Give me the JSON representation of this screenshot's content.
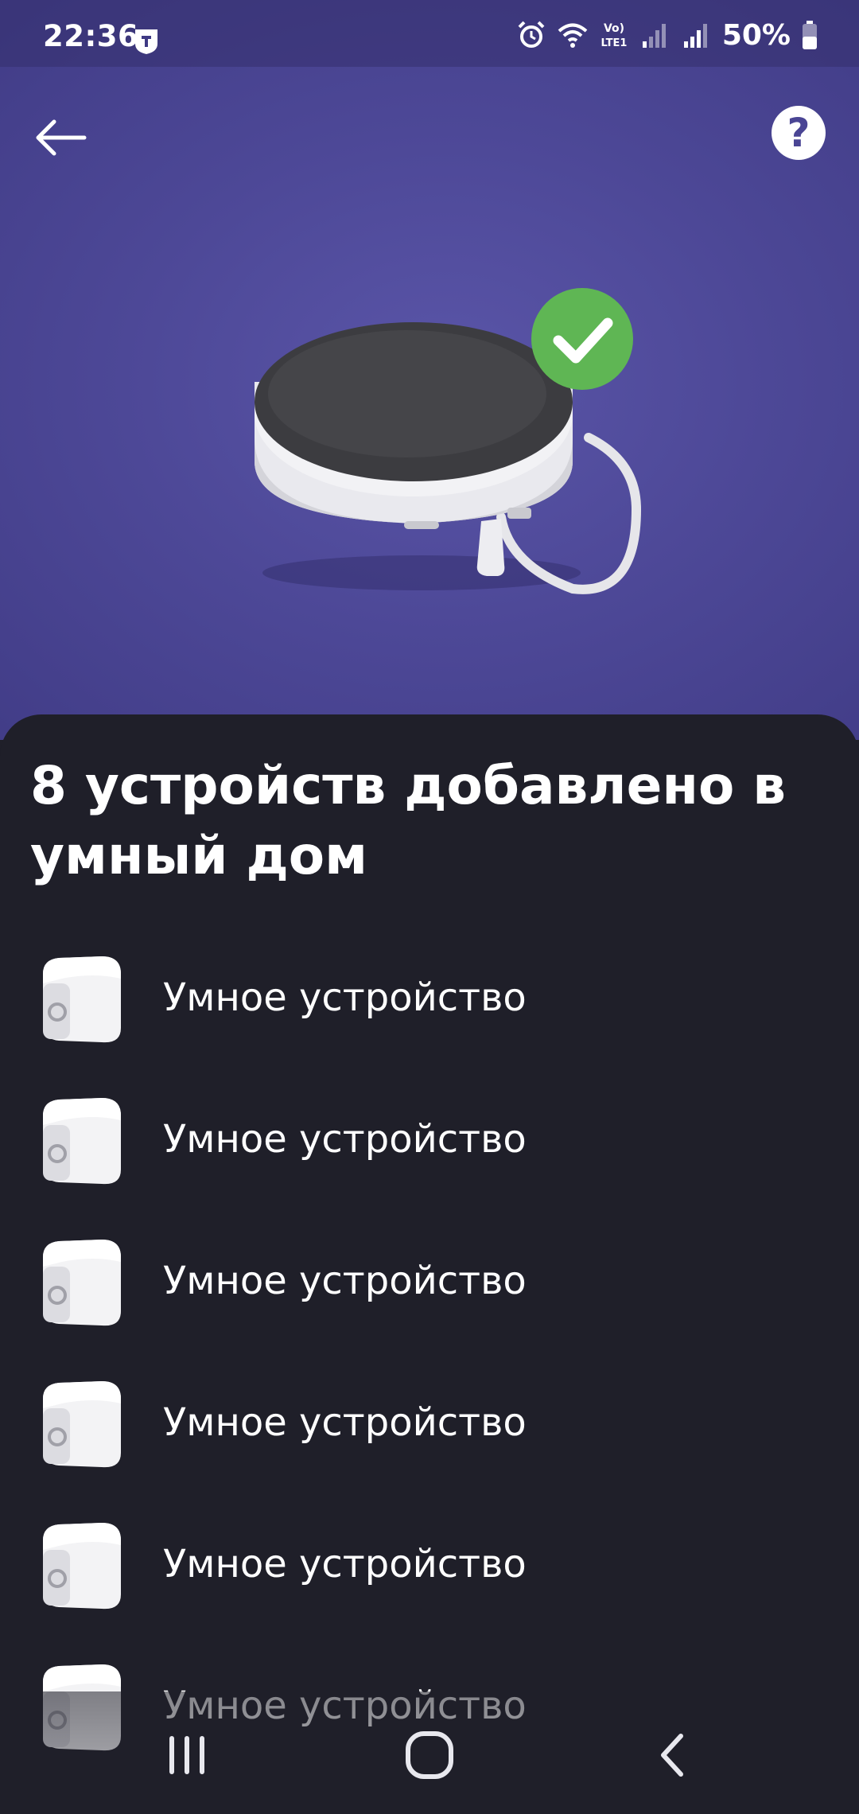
{
  "status_bar": {
    "time": "22:36",
    "battery_percent": "50%",
    "icons": [
      "tele2-icon",
      "alarm-icon",
      "wifi-icon",
      "volte-icon",
      "signal-icon",
      "signal-icon",
      "battery-icon"
    ],
    "lte_label_top": "Vo)",
    "lte_label_bottom": "LTE1"
  },
  "header": {
    "back_icon": "arrow-left-icon",
    "help_label": "?"
  },
  "hero": {
    "status_icon": "check-icon",
    "accent_color": "#5fb654",
    "background_color": "#4d4897"
  },
  "sheet": {
    "title": "8 устройств добавлено в умный дом",
    "devices": [
      {
        "label": "Умное устройство",
        "icon": "smart-device-icon"
      },
      {
        "label": "Умное устройство",
        "icon": "smart-device-icon"
      },
      {
        "label": "Умное устройство",
        "icon": "smart-device-icon"
      },
      {
        "label": "Умное устройство",
        "icon": "smart-device-icon"
      },
      {
        "label": "Умное устройство",
        "icon": "smart-device-icon"
      },
      {
        "label": "Умное устройство",
        "icon": "smart-device-icon"
      }
    ]
  },
  "nav_bar": {
    "buttons": [
      "recent-apps-icon",
      "home-icon",
      "back-icon"
    ]
  }
}
